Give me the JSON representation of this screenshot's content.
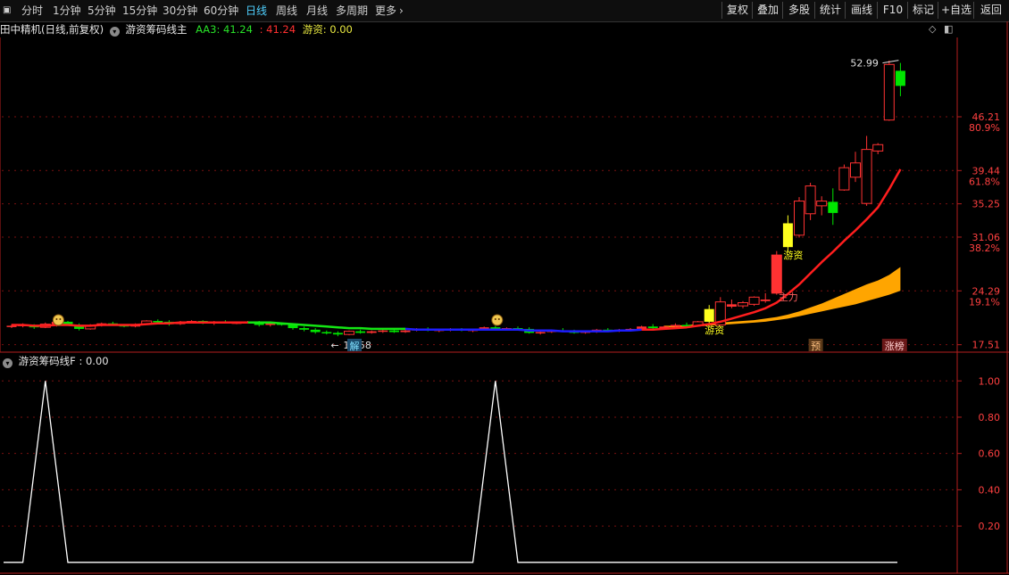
{
  "toolbar": {
    "left": [
      "分时",
      "1分钟",
      "5分钟",
      "15分钟",
      "30分钟",
      "60分钟",
      "日线",
      "周线",
      "月线",
      "多周期",
      "更多"
    ],
    "active": "日线",
    "right": [
      "复权",
      "叠加",
      "多股",
      "统计",
      "画线",
      "F10",
      "标记",
      "+自选",
      "返回"
    ]
  },
  "main_header": {
    "stock": "田中精机(日线,前复权)",
    "indicator": "游资筹码线主",
    "aa3_label": "AA3:",
    "aa3_value": "41.24",
    "aa3_value2": "41.24",
    "youzi_label": "游资:",
    "youzi_value": "0.00"
  },
  "sub_header": {
    "indicator": "游资筹码线F",
    "value": ": 0.00"
  },
  "colors": {
    "up": "#ff3232",
    "down": "#00e600",
    "ma_red": "#ff1e1e",
    "ma_green": "#14e614",
    "ma_blue": "#1e1eff",
    "band": "#ffa500",
    "signal": "#ffff1e",
    "grid": "#7a1010",
    "axis": "#b41e1e"
  },
  "chart_data": [
    {
      "type": "candlestick",
      "y_ticks": [
        {
          "value": 46.21,
          "pct": "80.9%"
        },
        {
          "value": 39.44,
          "pct": "61.8%"
        },
        {
          "value": 35.25,
          "pct": ""
        },
        {
          "value": 31.06,
          "pct": "38.2%"
        },
        {
          "value": 24.29,
          "pct": "19.1%"
        },
        {
          "value": 17.51,
          "pct": ""
        }
      ],
      "ylim": [
        16.8,
        56.2
      ],
      "high_annotation": "52.99",
      "low_annotation": "18.58",
      "candles": [
        [
          19.8,
          20.1,
          19.6,
          19.9
        ],
        [
          19.9,
          20.2,
          19.7,
          20.0
        ],
        [
          20.0,
          20.1,
          19.5,
          19.7
        ],
        [
          19.7,
          20.3,
          19.6,
          20.1
        ],
        [
          20.1,
          20.6,
          19.8,
          20.4
        ],
        [
          20.4,
          20.5,
          19.9,
          20.0
        ],
        [
          20.0,
          20.2,
          19.3,
          19.5
        ],
        [
          19.5,
          20.1,
          19.4,
          19.9
        ],
        [
          19.9,
          20.3,
          19.8,
          20.2
        ],
        [
          20.2,
          20.4,
          19.9,
          20.0
        ],
        [
          20.0,
          20.1,
          19.7,
          19.8
        ],
        [
          19.8,
          20.2,
          19.7,
          20.1
        ],
        [
          20.1,
          20.6,
          20.0,
          20.5
        ],
        [
          20.5,
          20.7,
          20.3,
          20.4
        ],
        [
          20.4,
          20.6,
          19.9,
          20.1
        ],
        [
          20.1,
          20.5,
          20.0,
          20.3
        ],
        [
          20.3,
          20.6,
          20.2,
          20.5
        ],
        [
          20.5,
          20.6,
          20.1,
          20.2
        ],
        [
          20.2,
          20.5,
          20.0,
          20.4
        ],
        [
          20.4,
          20.6,
          20.2,
          20.3
        ],
        [
          20.3,
          20.4,
          20.1,
          20.3
        ],
        [
          20.3,
          20.5,
          20.2,
          20.4
        ],
        [
          20.4,
          20.5,
          19.8,
          20.0
        ],
        [
          20.0,
          20.3,
          19.8,
          20.2
        ],
        [
          20.2,
          20.3,
          19.9,
          20.0
        ],
        [
          20.0,
          20.2,
          19.4,
          19.6
        ],
        [
          19.6,
          19.8,
          19.2,
          19.4
        ],
        [
          19.4,
          19.6,
          18.9,
          19.1
        ],
        [
          19.1,
          19.3,
          18.8,
          19.0
        ],
        [
          19.0,
          19.2,
          18.58,
          18.8
        ],
        [
          18.8,
          19.3,
          18.7,
          19.2
        ],
        [
          19.2,
          19.4,
          18.9,
          19.0
        ],
        [
          19.0,
          19.3,
          18.9,
          19.2
        ],
        [
          19.2,
          19.5,
          19.0,
          19.3
        ],
        [
          19.3,
          19.5,
          19.0,
          19.1
        ],
        [
          19.1,
          19.4,
          19.0,
          19.3
        ],
        [
          19.3,
          19.6,
          19.2,
          19.5
        ],
        [
          19.5,
          19.7,
          19.2,
          19.3
        ],
        [
          19.3,
          19.5,
          19.1,
          19.4
        ],
        [
          19.4,
          19.6,
          19.2,
          19.5
        ],
        [
          19.5,
          19.6,
          19.2,
          19.3
        ],
        [
          19.3,
          19.5,
          19.1,
          19.4
        ],
        [
          19.4,
          19.8,
          19.3,
          19.7
        ],
        [
          19.7,
          19.9,
          19.4,
          19.5
        ],
        [
          19.5,
          19.7,
          19.3,
          19.6
        ],
        [
          19.6,
          19.8,
          19.4,
          19.5
        ],
        [
          19.5,
          19.7,
          18.9,
          19.0
        ],
        [
          19.0,
          19.3,
          18.8,
          19.1
        ],
        [
          19.1,
          19.4,
          19.0,
          19.3
        ],
        [
          19.3,
          19.6,
          19.1,
          19.2
        ],
        [
          19.2,
          19.4,
          18.9,
          19.0
        ],
        [
          19.0,
          19.3,
          18.9,
          19.2
        ],
        [
          19.2,
          19.5,
          19.0,
          19.4
        ],
        [
          19.4,
          19.6,
          19.2,
          19.3
        ],
        [
          19.3,
          19.5,
          19.1,
          19.4
        ],
        [
          19.4,
          19.6,
          19.2,
          19.5
        ],
        [
          19.5,
          19.9,
          19.4,
          19.8
        ],
        [
          19.8,
          20.1,
          19.5,
          19.6
        ],
        [
          19.6,
          19.9,
          19.4,
          19.8
        ],
        [
          19.8,
          20.2,
          19.6,
          20.0
        ],
        [
          20.0,
          20.3,
          19.7,
          19.9
        ],
        [
          19.9,
          20.5,
          19.8,
          20.4
        ],
        [
          20.4,
          22.5,
          20.2,
          22.0
        ],
        [
          20.0,
          23.5,
          19.9,
          22.9
        ],
        [
          22.3,
          23.2,
          22.1,
          22.6
        ],
        [
          22.4,
          23.0,
          22.1,
          22.8
        ],
        [
          22.6,
          23.6,
          22.4,
          23.5
        ],
        [
          23.0,
          24.0,
          22.8,
          23.2
        ],
        [
          24.0,
          29.3,
          23.8,
          28.8
        ],
        [
          29.8,
          33.8,
          29.2,
          32.8
        ],
        [
          31.3,
          36.1,
          31.0,
          35.6
        ],
        [
          34.0,
          37.9,
          33.2,
          37.5
        ],
        [
          35.0,
          36.2,
          33.8,
          35.6
        ],
        [
          35.5,
          37.2,
          32.6,
          34.1
        ],
        [
          37.0,
          40.2,
          36.9,
          39.8
        ],
        [
          38.6,
          41.8,
          38.0,
          40.4
        ],
        [
          35.3,
          43.8,
          35.0,
          42.1
        ],
        [
          41.9,
          42.9,
          41.5,
          42.7
        ],
        [
          45.8,
          53.3,
          45.7,
          52.8
        ],
        [
          52.0,
          52.99,
          48.8,
          50.1
        ]
      ],
      "ma_line": [
        20.0,
        20.0,
        19.9,
        19.9,
        20.0,
        20.0,
        19.9,
        19.9,
        20.0,
        20.0,
        20.0,
        20.0,
        20.1,
        20.2,
        20.2,
        20.3,
        20.3,
        20.3,
        20.3,
        20.3,
        20.3,
        20.3,
        20.3,
        20.3,
        20.2,
        20.1,
        20.0,
        19.9,
        19.8,
        19.7,
        19.6,
        19.6,
        19.5,
        19.5,
        19.5,
        19.5,
        19.4,
        19.4,
        19.4,
        19.4,
        19.4,
        19.4,
        19.4,
        19.4,
        19.4,
        19.4,
        19.3,
        19.3,
        19.3,
        19.2,
        19.2,
        19.2,
        19.2,
        19.2,
        19.3,
        19.3,
        19.4,
        19.4,
        19.5,
        19.6,
        19.7,
        19.9,
        20.1,
        20.4,
        20.8,
        21.2,
        21.6,
        22.1,
        22.8,
        23.9,
        25.1,
        26.5,
        27.9,
        29.2,
        30.6,
        31.9,
        33.3,
        34.8,
        37.1,
        39.6
      ],
      "ma_segments": [
        {
          "from": 0,
          "to": 21,
          "color": "red"
        },
        {
          "from": 21,
          "to": 35,
          "color": "green"
        },
        {
          "from": 35,
          "to": 56,
          "color": "blue"
        },
        {
          "from": 56,
          "to": 79,
          "color": "red"
        }
      ],
      "band_upper": [
        19.9,
        19.9,
        20.0,
        20.1,
        20.2,
        20.3,
        20.4,
        20.5,
        20.6,
        20.8,
        21.0,
        21.3,
        21.7,
        22.2,
        22.7,
        23.3,
        23.9,
        24.5,
        25.1,
        25.6,
        26.3,
        27.3
      ],
      "band_lower": [
        19.7,
        19.7,
        19.8,
        19.8,
        19.9,
        20.0,
        20.1,
        20.2,
        20.3,
        20.4,
        20.6,
        20.8,
        21.1,
        21.4,
        21.7,
        22.0,
        22.3,
        22.6,
        23.0,
        23.4,
        23.8,
        24.3
      ],
      "band_start_index": 58,
      "signal_markers": [
        {
          "index": 62,
          "label": "游资"
        },
        {
          "index": 69,
          "label": "游资"
        }
      ],
      "event_markers": [
        {
          "index": 68,
          "label": "主力"
        }
      ],
      "bottom_tags": [
        {
          "index": 30,
          "label": "解"
        },
        {
          "index": 71,
          "label": "预"
        },
        {
          "index": 78,
          "label": "涨榜"
        }
      ],
      "face_markers": [
        4,
        43
      ]
    },
    {
      "type": "line",
      "y_ticks": [
        1.0,
        0.8,
        0.6,
        0.4,
        0.2
      ],
      "ylim": [
        -0.05,
        1.07
      ],
      "points": [
        [
          -1,
          0
        ],
        [
          1,
          0
        ],
        [
          3,
          1
        ],
        [
          5,
          0
        ],
        [
          41,
          0
        ],
        [
          43,
          1
        ],
        [
          45,
          0
        ],
        [
          79,
          0
        ]
      ]
    }
  ]
}
